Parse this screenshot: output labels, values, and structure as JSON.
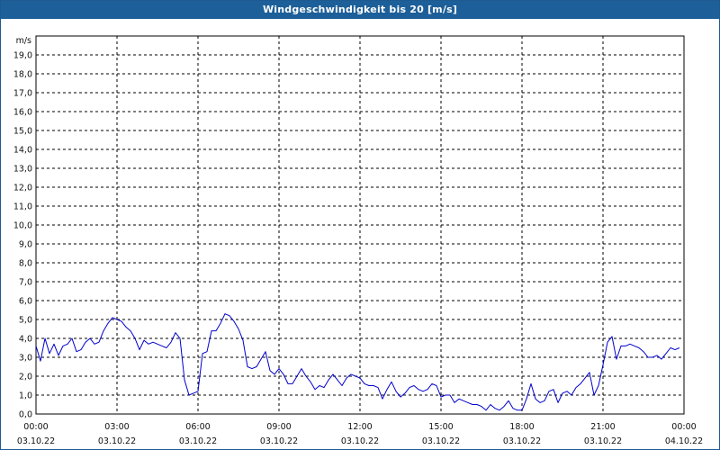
{
  "title": "Windgeschwindigkeit bis 20 [m/s]",
  "chart_data": {
    "type": "line",
    "title": "Windgeschwindigkeit bis 20 [m/s]",
    "ylabel": "m/s",
    "xlabel": "",
    "ylim": [
      0,
      20
    ],
    "xlim_hours": [
      0,
      24
    ],
    "grid": true,
    "line_color": "#0000cc",
    "y_ticks": [
      "0,0",
      "1,0",
      "2,0",
      "3,0",
      "4,0",
      "5,0",
      "6,0",
      "7,0",
      "8,0",
      "9,0",
      "10,0",
      "11,0",
      "12,0",
      "13,0",
      "14,0",
      "15,0",
      "16,0",
      "17,0",
      "18,0",
      "19,0"
    ],
    "x_ticks": [
      {
        "time": "00:00",
        "date": "03.10.22"
      },
      {
        "time": "03:00",
        "date": "03.10.22"
      },
      {
        "time": "06:00",
        "date": "03.10.22"
      },
      {
        "time": "09:00",
        "date": "03.10.22"
      },
      {
        "time": "12:00",
        "date": "03.10.22"
      },
      {
        "time": "15:00",
        "date": "03.10.22"
      },
      {
        "time": "18:00",
        "date": "03.10.22"
      },
      {
        "time": "21:00",
        "date": "03.10.22"
      },
      {
        "time": "00:00",
        "date": "04.10.22"
      }
    ],
    "series": [
      {
        "x": [
          "00:00",
          "00:10",
          "00:20",
          "00:30",
          "00:40",
          "00:50",
          "01:00",
          "01:10",
          "01:20",
          "01:30",
          "01:40",
          "01:50",
          "02:00",
          "02:10",
          "02:20",
          "02:30",
          "02:40",
          "02:50",
          "03:00",
          "03:10",
          "03:20",
          "03:30",
          "03:40",
          "03:50",
          "04:00",
          "04:10",
          "04:20",
          "04:30",
          "04:40",
          "04:50",
          "05:00",
          "05:10",
          "05:20",
          "05:30",
          "05:40",
          "05:50",
          "06:00",
          "06:10",
          "06:20",
          "06:30",
          "06:40",
          "06:50",
          "07:00",
          "07:10",
          "07:20",
          "07:30",
          "07:40",
          "07:50",
          "08:00",
          "08:10",
          "08:20",
          "08:30",
          "08:40",
          "08:50",
          "09:00",
          "09:10",
          "09:20",
          "09:30",
          "09:40",
          "09:50",
          "10:00",
          "10:10",
          "10:20",
          "10:30",
          "10:40",
          "10:50",
          "11:00",
          "11:10",
          "11:20",
          "11:30",
          "11:40",
          "11:50",
          "12:00",
          "12:10",
          "12:20",
          "12:30",
          "12:40",
          "12:50",
          "13:00",
          "13:10",
          "13:20",
          "13:30",
          "13:40",
          "13:50",
          "14:00",
          "14:10",
          "14:20",
          "14:30",
          "14:40",
          "14:50",
          "15:00",
          "15:10",
          "15:20",
          "15:30",
          "15:40",
          "15:50",
          "16:00",
          "16:10",
          "16:20",
          "16:30",
          "16:40",
          "16:50",
          "17:00",
          "17:10",
          "17:20",
          "17:30",
          "17:40",
          "17:50",
          "18:00",
          "18:10",
          "18:20",
          "18:30",
          "18:40",
          "18:50",
          "19:00",
          "19:10",
          "19:20",
          "19:30",
          "19:40",
          "19:50",
          "20:00",
          "20:10",
          "20:20",
          "20:30",
          "20:40",
          "20:50",
          "21:00",
          "21:10",
          "21:20",
          "21:30",
          "21:40",
          "21:50",
          "22:00",
          "22:10",
          "22:20",
          "22:30",
          "22:40",
          "22:50",
          "23:00",
          "23:10",
          "23:20",
          "23:30",
          "23:40",
          "23:50"
        ],
        "values": [
          3.6,
          2.8,
          4.0,
          3.2,
          3.7,
          3.1,
          3.6,
          3.7,
          4.0,
          3.3,
          3.4,
          3.8,
          4.0,
          3.7,
          3.8,
          4.4,
          4.8,
          5.1,
          5.0,
          4.9,
          4.6,
          4.4,
          4.0,
          3.4,
          3.9,
          3.7,
          3.8,
          3.7,
          3.6,
          3.5,
          3.8,
          4.3,
          4.0,
          1.8,
          1.0,
          1.1,
          1.2,
          3.2,
          3.3,
          4.4,
          4.4,
          4.8,
          5.3,
          5.2,
          4.9,
          4.5,
          3.9,
          2.5,
          2.4,
          2.5,
          2.9,
          3.3,
          2.3,
          2.1,
          2.4,
          2.1,
          1.6,
          1.6,
          2.0,
          2.4,
          2.0,
          1.7,
          1.3,
          1.5,
          1.4,
          1.8,
          2.1,
          1.8,
          1.5,
          1.9,
          2.1,
          2.0,
          1.9,
          1.6,
          1.5,
          1.5,
          1.4,
          0.8,
          1.3,
          1.7,
          1.2,
          0.9,
          1.1,
          1.4,
          1.5,
          1.3,
          1.2,
          1.3,
          1.6,
          1.5,
          0.9,
          1.0,
          1.0,
          0.6,
          0.8,
          0.7,
          0.6,
          0.5,
          0.5,
          0.4,
          0.2,
          0.5,
          0.3,
          0.2,
          0.4,
          0.7,
          0.3,
          0.2,
          0.2,
          0.8,
          1.6,
          0.8,
          0.6,
          0.7,
          1.2,
          1.3,
          0.6,
          1.1,
          1.2,
          1.0,
          1.4,
          1.6,
          1.9,
          2.2,
          1.0,
          1.5,
          2.6,
          3.8,
          4.1,
          2.9,
          3.6,
          3.6,
          3.7,
          3.6,
          3.5,
          3.3,
          3.0,
          3.0,
          3.1,
          2.9,
          3.2,
          3.5,
          3.4,
          3.5
        ]
      }
    ]
  }
}
